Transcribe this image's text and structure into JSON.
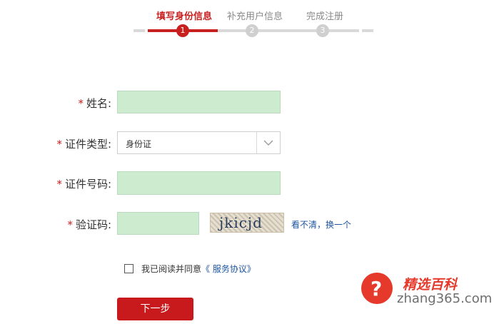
{
  "steps": [
    {
      "label": "填写身份信息",
      "number": "1",
      "active": true
    },
    {
      "label": "补充用户信息",
      "number": "2",
      "active": false
    },
    {
      "label": "完成注册",
      "number": "3",
      "active": false
    }
  ],
  "form": {
    "required_mark": "*",
    "name_label": "姓名:",
    "id_type_label": "证件类型:",
    "id_type_value": "身份证",
    "id_number_label": "证件号码:",
    "captcha_label": "验证码:",
    "captcha_text": "jkicjd",
    "refresh_link": "看不清，换一个",
    "agree_text": "我已阅读并同意",
    "agreement_link": "《 服务协议》",
    "next_button": "下一步"
  },
  "watermark": {
    "title": "精选百科",
    "url": "zhang365.com",
    "icon_glyph": "?"
  },
  "colors": {
    "accent": "#c81f1f",
    "input_fill": "#cdebcf",
    "link": "#1d55a0"
  }
}
